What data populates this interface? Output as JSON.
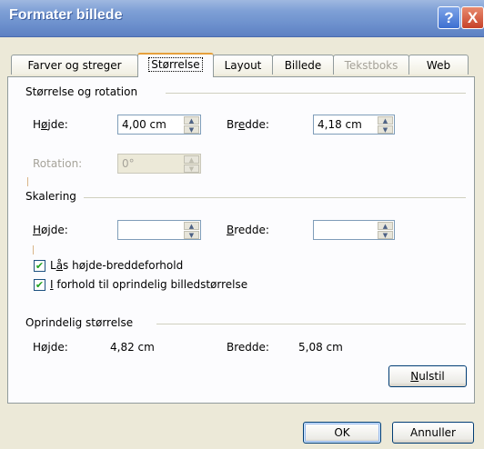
{
  "window": {
    "title": "Formater billede",
    "help_glyph": "?",
    "close_glyph": "X"
  },
  "tabs": [
    {
      "label": "Farver og streger"
    },
    {
      "label": "Størrelse"
    },
    {
      "label": "Layout"
    },
    {
      "label": "Billede"
    },
    {
      "label": "Tekstboks"
    },
    {
      "label": "Web"
    }
  ],
  "size_rotation": {
    "heading": "Størrelse og rotation",
    "height_label_pre": "H",
    "height_label_u": "ø",
    "height_label_post": "jde:",
    "height_value": "4,00 cm",
    "width_label_pre": "Br",
    "width_label_u": "e",
    "width_label_post": "dde:",
    "width_value": "4,18 cm",
    "rotation_label": "Rotation:",
    "rotation_value": "0°"
  },
  "scaling": {
    "heading": "Skalering",
    "height_label_u": "H",
    "height_label_post": "øjde:",
    "height_value": "",
    "width_label_u": "B",
    "width_label_post": "redde:",
    "width_value": "",
    "lock_label_pre": "L",
    "lock_label_u": "å",
    "lock_label_post": "s højde-breddeforhold",
    "lock_checked": "✔",
    "relative_label_u": "I",
    "relative_label_post": " forhold til oprindelig billedstørrelse",
    "relative_checked": "✔"
  },
  "original": {
    "heading": "Oprindelig størrelse",
    "height_label": "Højde:",
    "height_value": "4,82 cm",
    "width_label": "Bredde:",
    "width_value": "5,08 cm",
    "reset_u": "N",
    "reset_post": "ulstil"
  },
  "footer": {
    "ok": "OK",
    "cancel": "Annuller"
  },
  "icons": {
    "up": "▲",
    "down": "▼"
  }
}
